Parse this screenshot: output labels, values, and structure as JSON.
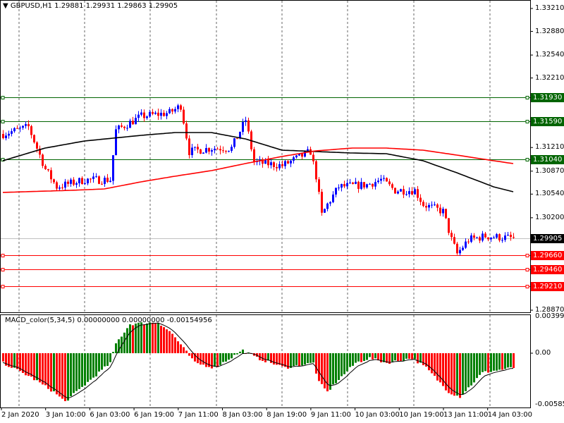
{
  "header": {
    "symbol": "GBPUSD,H1",
    "open": "1.29881",
    "high": "1.29931",
    "low": "1.29863",
    "close": "1.29905"
  },
  "macd_header": {
    "name": "MACD_color(5,34,5)",
    "v1": "0.00000000",
    "v2": "0.00000000",
    "v3": "-0.00154956"
  },
  "price_axis": [
    "1.33210",
    "1.32880",
    "1.32540",
    "1.32210",
    "1.31210",
    "1.30870",
    "1.30540",
    "1.30200",
    "1.28870"
  ],
  "levels": [
    {
      "price": "1.31930",
      "color": "#006400"
    },
    {
      "price": "1.31590",
      "color": "#006400"
    },
    {
      "price": "1.31040",
      "color": "#006400"
    },
    {
      "price": "1.29905",
      "color": "#000000",
      "current": true
    },
    {
      "price": "1.29660",
      "color": "#ff0000"
    },
    {
      "price": "1.29460",
      "color": "#ff0000"
    },
    {
      "price": "1.29210",
      "color": "#ff0000"
    }
  ],
  "macd_axis": [
    "0.0039981",
    "0.00",
    "-0.005854"
  ],
  "time_axis": [
    "2 Jan 2020",
    "3 Jan 10:00",
    "6 Jan 03:00",
    "6 Jan 19:00",
    "7 Jan 11:00",
    "8 Jan 03:00",
    "8 Jan 19:00",
    "9 Jan 11:00",
    "10 Jan 03:00",
    "10 Jan 19:00",
    "13 Jan 11:00",
    "14 Jan 03:00"
  ],
  "chart_data": {
    "type": "candlestick",
    "bars": 182,
    "ylim": [
      1.2887,
      1.3321
    ],
    "close_path": [
      [
        0,
        1.31405
      ],
      [
        9,
        1.31507
      ],
      [
        15,
        1.30898
      ],
      [
        19,
        1.30645
      ],
      [
        29,
        1.30746
      ],
      [
        38,
        1.30746
      ],
      [
        40,
        1.31456
      ],
      [
        49,
        1.31659
      ],
      [
        59,
        1.31709
      ],
      [
        63,
        1.31811
      ],
      [
        66,
        1.31152
      ],
      [
        74,
        1.31202
      ],
      [
        81,
        1.31202
      ],
      [
        86,
        1.31608
      ],
      [
        89,
        1.31
      ],
      [
        99,
        1.30949
      ],
      [
        109,
        1.31152
      ],
      [
        111,
        1.30797
      ],
      [
        113,
        1.30239
      ],
      [
        115,
        1.30391
      ],
      [
        119,
        1.30645
      ],
      [
        129,
        1.30675
      ],
      [
        134,
        1.30746
      ],
      [
        139,
        1.30594
      ],
      [
        146,
        1.30594
      ],
      [
        149,
        1.30391
      ],
      [
        156,
        1.3029
      ],
      [
        159,
        1.29884
      ],
      [
        161,
        1.29681
      ],
      [
        165,
        1.29884
      ],
      [
        171,
        1.29935
      ],
      [
        181,
        1.29905
      ]
    ],
    "ma_black": [
      [
        0,
        1.3102
      ],
      [
        15,
        1.31202
      ],
      [
        29,
        1.31304
      ],
      [
        49,
        1.31385
      ],
      [
        61,
        1.31425
      ],
      [
        74,
        1.31425
      ],
      [
        86,
        1.31334
      ],
      [
        99,
        1.31172
      ],
      [
        111,
        1.31152
      ],
      [
        124,
        1.31131
      ],
      [
        136,
        1.31121
      ],
      [
        149,
        1.3102
      ],
      [
        161,
        1.30847
      ],
      [
        174,
        1.30645
      ],
      [
        181,
        1.30574
      ]
    ],
    "ma_red": [
      [
        0,
        1.30564
      ],
      [
        24,
        1.30594
      ],
      [
        36,
        1.30614
      ],
      [
        49,
        1.30716
      ],
      [
        61,
        1.30797
      ],
      [
        74,
        1.30878
      ],
      [
        86,
        1.30979
      ],
      [
        99,
        1.31081
      ],
      [
        111,
        1.31162
      ],
      [
        124,
        1.31202
      ],
      [
        136,
        1.31202
      ],
      [
        149,
        1.31172
      ],
      [
        161,
        1.31101
      ],
      [
        174,
        1.3102
      ],
      [
        181,
        1.30979
      ]
    ],
    "macd_hist": [
      [
        0,
        -0.001
      ],
      [
        10,
        -0.0025
      ],
      [
        18,
        -0.004
      ],
      [
        22,
        -0.005
      ],
      [
        30,
        -0.003
      ],
      [
        38,
        -0.001
      ],
      [
        40,
        0.001
      ],
      [
        45,
        0.003
      ],
      [
        55,
        0.0032
      ],
      [
        60,
        0.002
      ],
      [
        68,
        -0.001
      ],
      [
        75,
        -0.0015
      ],
      [
        85,
        0.0003
      ],
      [
        90,
        -0.0005
      ],
      [
        100,
        -0.0015
      ],
      [
        110,
        -0.001
      ],
      [
        112,
        -0.003
      ],
      [
        115,
        -0.004
      ],
      [
        118,
        -0.003
      ],
      [
        125,
        -0.001
      ],
      [
        130,
        -0.0005
      ],
      [
        136,
        -0.001
      ],
      [
        145,
        -0.0005
      ],
      [
        150,
        -0.0015
      ],
      [
        158,
        -0.004
      ],
      [
        162,
        -0.0045
      ],
      [
        170,
        -0.002
      ],
      [
        181,
        -0.0015
      ]
    ],
    "macd_ylim": [
      -0.005854,
      0.0039981
    ],
    "up_color": "#0000ff",
    "down_color": "#ff0000"
  }
}
